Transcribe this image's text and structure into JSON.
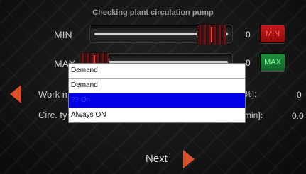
{
  "title": "Checking plant circulation pump",
  "min_row": {
    "label": "MIN",
    "value": "0",
    "button_label": "MIN",
    "slider_level": 0.85
  },
  "max_row": {
    "label": "MAX",
    "value": "0",
    "button_label": "MAX",
    "slider_level": 0.0
  },
  "work_row": {
    "label": "Work m",
    "unit": "%]:",
    "value": "0"
  },
  "circ_row": {
    "label": "Circ. ty",
    "unit": "min]:",
    "value": "0.0"
  },
  "dropdown": {
    "selected": "Demand",
    "options": [
      "Demand",
      "?? On",
      "Always ON"
    ],
    "highlighted_index": 1
  },
  "footer": {
    "next_label": "Next"
  },
  "icons": {
    "prev": "chevron-left-icon",
    "next": "chevron-right-icon"
  },
  "colors": {
    "accent_orange": "#d9512a",
    "min_button": "#c31818",
    "max_button": "#1f8f3c",
    "highlight": "#0000e6"
  }
}
